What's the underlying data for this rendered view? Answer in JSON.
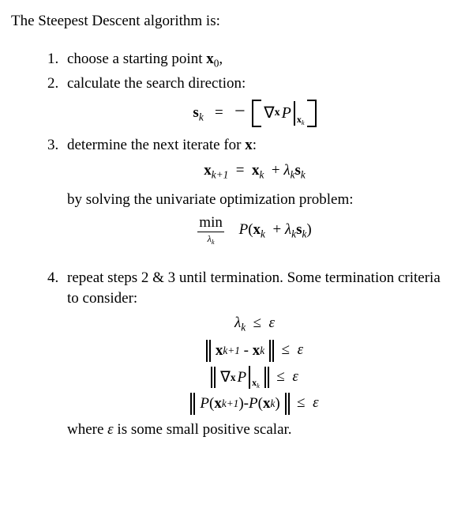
{
  "intro": "The Steepest Descent algorithm is:",
  "steps": {
    "s1": {
      "text_a": "choose a starting point ",
      "var": "x",
      "sub": "0",
      "text_b": ","
    },
    "s2": {
      "text": "calculate the search direction:",
      "eq": {
        "lhs_bold": "s",
        "lhs_sub": "k",
        "eqsym": "=",
        "neg": "−",
        "grad_nabla": "∇",
        "grad_sub": "x",
        "grad_P": "P",
        "grad_evalbold": "x",
        "grad_evalsub": "k"
      }
    },
    "s3": {
      "text": "determine the next iterate for ",
      "var": "x",
      "colon": ":",
      "eq1": {
        "xb": "x",
        "kp1": "k+1",
        "eq": "=",
        "xb2": "x",
        "k": "k",
        "plus": "+",
        "lam": "λ",
        "lamk": "k",
        "sb": "s",
        "sk": "k"
      },
      "by": "by solving the univariate optimization problem:",
      "eq2": {
        "min": "min",
        "min_sub_lam": "λ",
        "min_sub_k": "k",
        "P": "P",
        "open": "(",
        "xb": "x",
        "k": "k",
        "plus": "+",
        "lam": "λ",
        "lamk": "k",
        "sb": "s",
        "sk": "k",
        "close": ")"
      }
    },
    "s4": {
      "text": "repeat steps 2 & 3 until termination. Some termination criteria to consider:",
      "c1": {
        "lam": "λ",
        "k": "k",
        "le": "≤",
        "eps": "ε"
      },
      "c2": {
        "xb": "x",
        "kp1": "k+1",
        "minus": "-",
        "xb2": "x",
        "k": "k",
        "le": "≤",
        "eps": "ε"
      },
      "c3": {
        "nabla": "∇",
        "nsub": "x",
        "P": "P",
        "evb": "x",
        "evs": "k",
        "le": "≤",
        "eps": "ε"
      },
      "c4": {
        "P": "P",
        "open": "(",
        "xb": "x",
        "kp1": "k+1",
        "close": ")",
        "minus": "-",
        "P2": "P",
        "open2": "(",
        "xb2": "x",
        "k": "k",
        "close2": ")",
        "le": "≤",
        "eps": "ε"
      },
      "where_a": "where ",
      "where_eps": "ε",
      "where_b": " is some small positive scalar."
    }
  }
}
